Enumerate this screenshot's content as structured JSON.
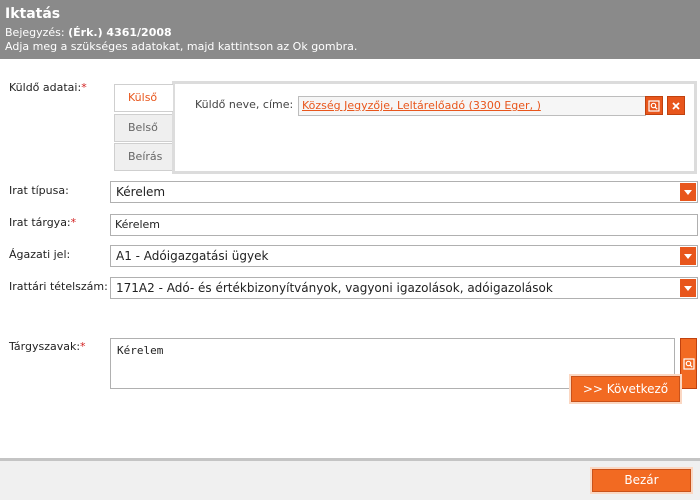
{
  "header": {
    "title": "Iktatás",
    "entry_prefix": "Bejegyzés: ",
    "entry_value": "(Érk.) 4361/2008",
    "instruction": "Adja meg a szükséges adatokat, majd kattintson az Ok gombra."
  },
  "form": {
    "sender": {
      "label": "Küldő adatai:",
      "tabs": [
        "Külső",
        "Belső",
        "Beírás"
      ],
      "active_tab": "Külső",
      "name_label": "Küldő neve, címe:",
      "name_value": "Község Jegyzője, Leltárelőadó (3300 Eger, )"
    },
    "doc_type": {
      "label": "Irat típusa:",
      "value": "Kérelem"
    },
    "subject": {
      "label": "Irat tárgya:",
      "value": "Kérelem"
    },
    "sector": {
      "label": "Ágazati jel:",
      "value": "A1 - Adóigazgatási ügyek"
    },
    "filing": {
      "label": "Irattári tételszám:",
      "value": "171A2 - Adó- és értékbizonyítványok, vagyoni igazolások, adóigazolások"
    },
    "keywords": {
      "label": "Tárgyszavak:",
      "value": "Kérelem"
    },
    "required_mark": "*"
  },
  "buttons": {
    "next": ">> Következő",
    "close": "Bezár"
  },
  "icons": {
    "search": "search-icon",
    "clear": "close-icon",
    "dropdown": "chevron-down-icon"
  },
  "colors": {
    "accent": "#f26a22",
    "header_bg": "#8a8a8a",
    "required": "#d21f1f"
  }
}
